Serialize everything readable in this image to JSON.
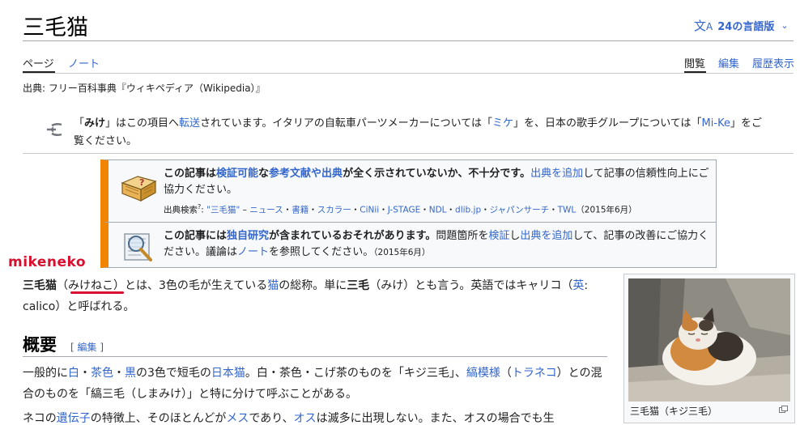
{
  "header": {
    "title": "三毛猫",
    "lang_label": "24の言語版",
    "lang_icon": "translate-icon"
  },
  "tabs": {
    "page": "ページ",
    "talk": "ノート",
    "read": "閲覧",
    "edit": "編集",
    "history": "履歴表示"
  },
  "source": "出典: フリー百科事典『ウィキペディア（Wikipedia）』",
  "hatnote": {
    "p1": "「",
    "b1": "みけ",
    "p2": "」はこの項目へ",
    "l1": "転送",
    "p3": "されています。イタリアの自転車パーツメーカーについては「",
    "l2": "ミケ",
    "p4": "」を、日本の歌手グループについては「",
    "l3": "Mi-Ke",
    "p5": "」をご覧ください。"
  },
  "ambox1": {
    "b1": "この記事は",
    "l1": "検証可能",
    "b2": "な",
    "l2": "参考文献や出典",
    "b3": "が全く示されていないか、不十分です。",
    "l3": "出典を追加",
    "t1": "して記事の信頼性向上にご協力ください。",
    "search_label": "出典検索",
    "search_sup": "?",
    "search_sep": ": ",
    "s_query": "\"三毛猫\"",
    "s_dash": " – ",
    "s_news": "ニュース",
    "s_books": "書籍",
    "s_scholar": "スカラー",
    "s_cinii": "CiNii",
    "s_jstage": "J-STAGE",
    "s_ndl": "NDL",
    "s_dlib": "dlib.jp",
    "s_japansearch": "ジャパンサーチ",
    "s_twl": "TWL",
    "s_dot": "・",
    "s_date": "（2015年6月）"
  },
  "ambox2": {
    "b1": "この記事には",
    "l1": "独自研究",
    "b2": "が含まれているおそれがあります。",
    "t1": "問題箇所を",
    "l2": "検証",
    "t2": "し",
    "l3": "出典を追加",
    "t3": "して、記事の改善にご協力ください。議論は",
    "l4": "ノート",
    "t4": "を参照してください。",
    "date": "（2015年6月）"
  },
  "annotation": "mikeneko",
  "lead": {
    "b1": "三毛猫",
    "t1": "（みけねこ）とは、3色の毛が生えている",
    "l1": "猫",
    "t2": "の総称。単に",
    "b2": "三毛",
    "t3": "（みけ）とも言う。英語ではキャリコ（",
    "l2": "英",
    "t4": ": calico）と呼ばれる。"
  },
  "section": {
    "title": "概要",
    "edit_open": "[ ",
    "edit_label": "編集",
    "edit_close": " ]"
  },
  "para2": {
    "t1": "一般的に",
    "l1": "白",
    "t2": "・",
    "l2": "茶色",
    "t3": "・",
    "l3": "黒",
    "t4": "の3色で短毛の",
    "l4": "日本猫",
    "t5": "。白・茶色・こげ茶のものを「キジ三毛」、",
    "l5": "縞模様",
    "t6": "（",
    "l6": "トラネコ",
    "t7": "）との混合のものを「縞三毛（しまみけ）」と特に分けて呼ぶことがある。"
  },
  "para3": {
    "t1": "ネコの",
    "l1": "遺伝子",
    "t2": "の特徴上、そのほとんどが",
    "l2": "メス",
    "t3": "であり、",
    "l3": "オス",
    "t4": "は滅多に出現しない。また、オスの場合でも生"
  },
  "thumb": {
    "caption": "三毛猫（キジ三毛）"
  },
  "colors": {
    "link": "#3366cc",
    "ambox_border": "#f28500",
    "annotation_red": "#d80f2f"
  }
}
